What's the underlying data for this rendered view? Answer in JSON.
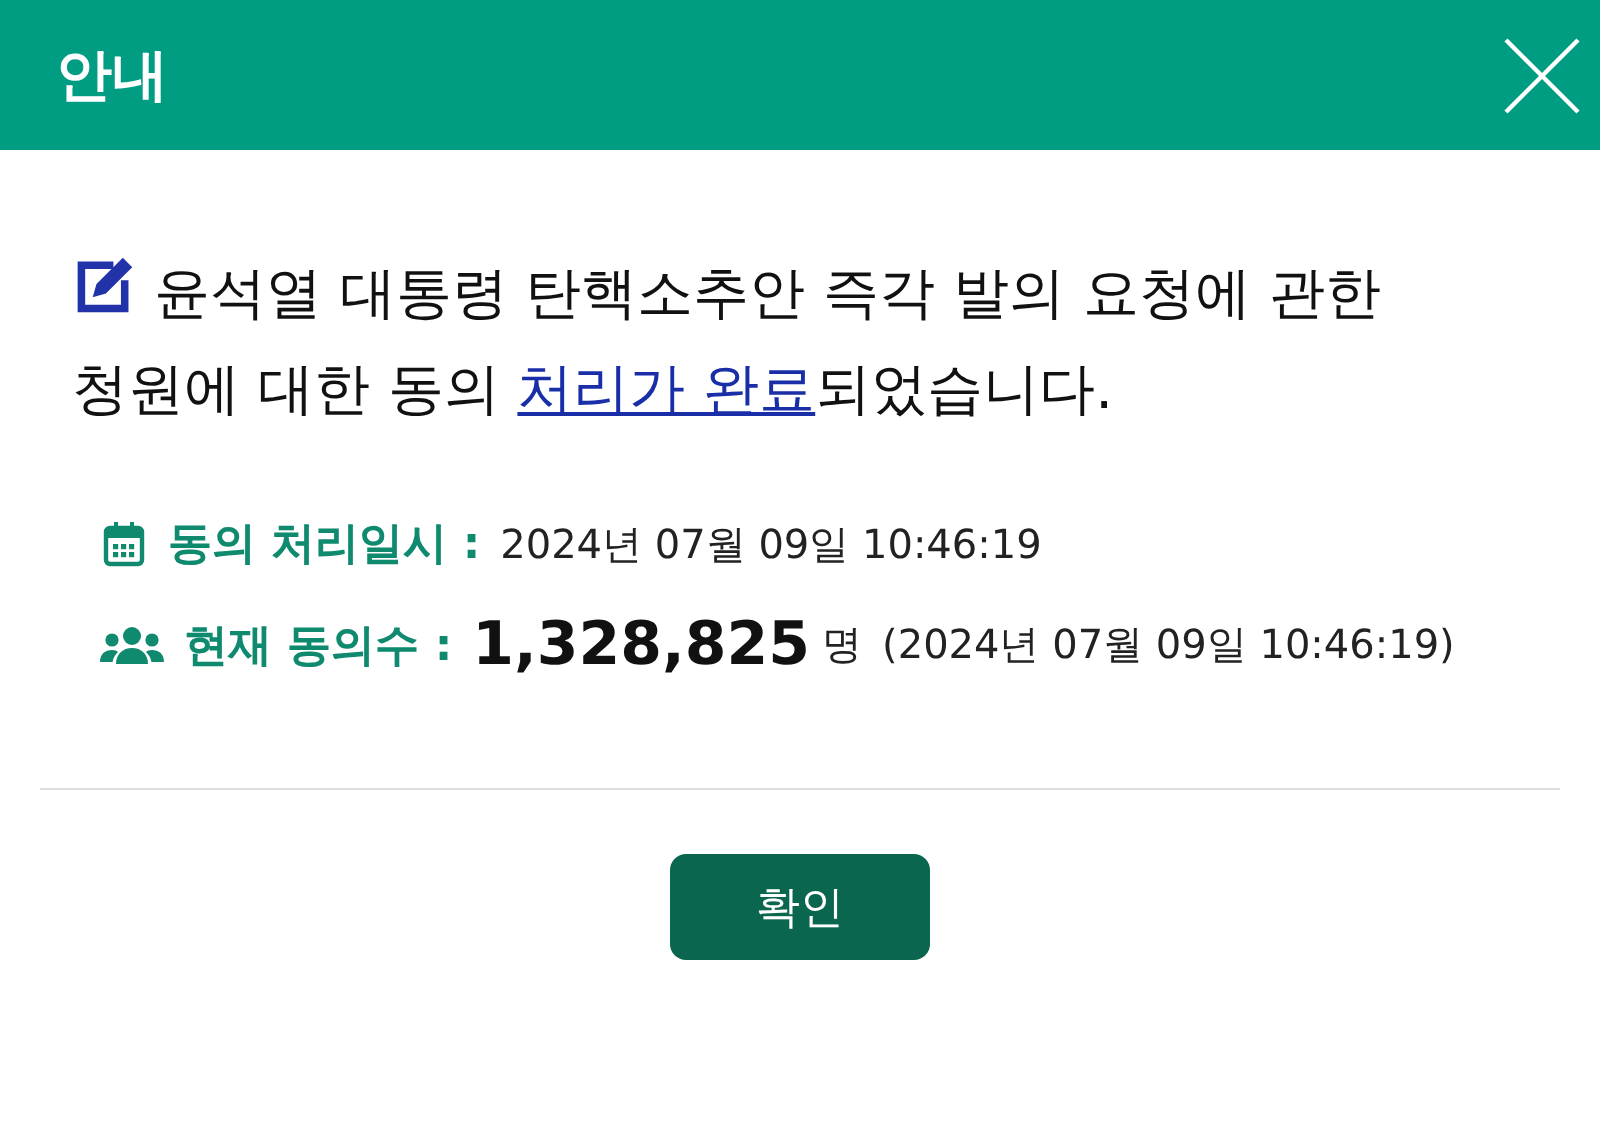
{
  "dialog": {
    "title": "안내"
  },
  "message": {
    "before": "윤석열 대통령 탄핵소추안 즉각 발의 요청에 관한 청원에 대한 동의 ",
    "link": "처리가 완료",
    "after": "되었습니다."
  },
  "details": [
    {
      "kind": "date",
      "label": "동의 처리일시 :",
      "value": "2024년 07월 09일 10:46:19"
    },
    {
      "kind": "count",
      "label": "현재 동의수 :",
      "count": "1,328,825",
      "unit": "명",
      "value": "(2024년 07월 09일 10:46:19)"
    }
  ],
  "buttons": [
    "확인"
  ]
}
